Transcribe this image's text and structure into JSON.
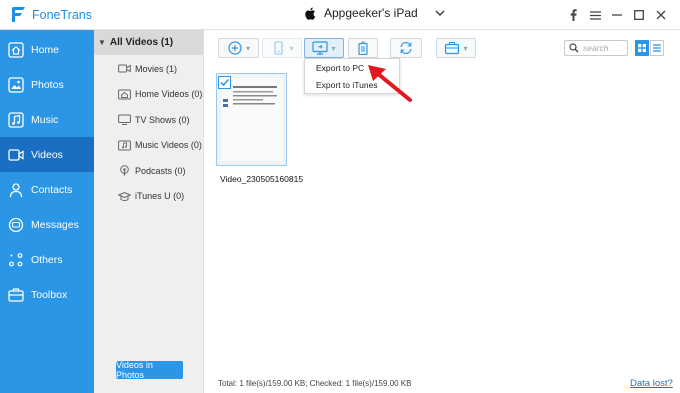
{
  "app": {
    "name": "FoneTrans",
    "accent": "#2b95e6",
    "accent_dark": "#1b6fc2"
  },
  "device": {
    "name": "Appgeeker's iPad",
    "icon": "apple-icon"
  },
  "window_controls": [
    "facebook-icon",
    "menu-icon",
    "minimize-icon",
    "maximize-icon",
    "close-icon"
  ],
  "nav": {
    "items": [
      {
        "label": "Home",
        "icon": "home-icon"
      },
      {
        "label": "Photos",
        "icon": "photos-icon"
      },
      {
        "label": "Music",
        "icon": "music-icon"
      },
      {
        "label": "Videos",
        "icon": "videos-icon",
        "active": true
      },
      {
        "label": "Contacts",
        "icon": "contacts-icon"
      },
      {
        "label": "Messages",
        "icon": "messages-icon"
      },
      {
        "label": "Others",
        "icon": "others-icon"
      },
      {
        "label": "Toolbox",
        "icon": "toolbox-icon"
      }
    ]
  },
  "categories": {
    "header": "All Videos (1)",
    "items": [
      {
        "label": "Movies (1)",
        "icon": "movies-icon"
      },
      {
        "label": "Home Videos (0)",
        "icon": "home-videos-icon"
      },
      {
        "label": "TV Shows (0)",
        "icon": "tv-icon"
      },
      {
        "label": "Music Videos (0)",
        "icon": "music-videos-icon"
      },
      {
        "label": "Podcasts (0)",
        "icon": "podcast-icon"
      },
      {
        "label": "iTunes U (0)",
        "icon": "itunes-u-icon"
      }
    ],
    "videos_in_photos": "Videos in Photos"
  },
  "toolbar": {
    "buttons": [
      "add-icon",
      "export-to-device-icon",
      "export-to-pc-icon",
      "delete-icon",
      "sync-icon",
      "toolbox-icon"
    ],
    "search_placeholder": "search"
  },
  "export_menu": {
    "items": [
      "Export to PC",
      "Export to iTunes"
    ]
  },
  "files": [
    {
      "name": "Video_230505160815",
      "checked": true
    }
  ],
  "status": {
    "text": "Total: 1 file(s)/159.00 KB; Checked: 1 file(s)/159.00 KB",
    "data_lost": "Data lost?"
  }
}
